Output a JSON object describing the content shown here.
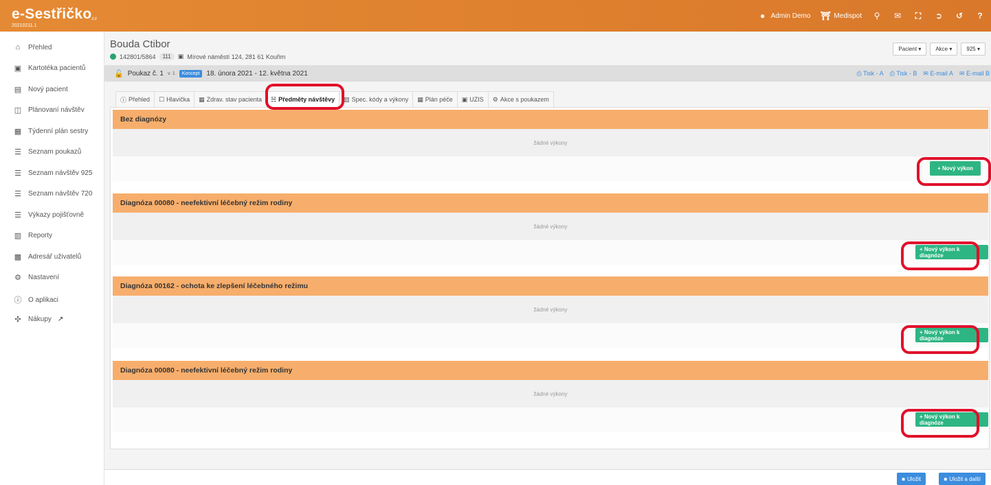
{
  "app": {
    "logo": "e-Sestřičko",
    "logo_tld": ".cz",
    "version": "20210211.1"
  },
  "topbar": {
    "user": "Admin Demo",
    "org": "Medispot"
  },
  "sidebar": {
    "items": [
      {
        "label": "Přehled",
        "icon": "home-icon"
      },
      {
        "label": "Kartotéka pacientů",
        "icon": "card-icon"
      },
      {
        "label": "Nový pacient",
        "icon": "id-icon"
      },
      {
        "label": "Plánovaní návštěv",
        "icon": "map-icon"
      },
      {
        "label": "Týdenní plán sestry",
        "icon": "calendar-icon"
      },
      {
        "label": "Seznam poukazů",
        "icon": "list-icon"
      },
      {
        "label": "Seznam návštěv 925",
        "icon": "list-icon"
      },
      {
        "label": "Seznam návštěv 720",
        "icon": "list-icon"
      },
      {
        "label": "Výkazy pojišťovně",
        "icon": "list-icon"
      },
      {
        "label": "Reporty",
        "icon": "chart-icon"
      },
      {
        "label": "Adresář uživatelů",
        "icon": "contact-icon"
      },
      {
        "label": "Nastavení",
        "icon": "gear-icon"
      },
      {
        "label": "O aplikaci",
        "icon": "info-icon"
      },
      {
        "label": "Nákupy",
        "icon": "cart-icon"
      }
    ]
  },
  "patient": {
    "name": "Bouda Ctibor",
    "id": "142801/5864",
    "insurance": "111",
    "address": "Mírové náměstí 124, 281 61 Kouřim"
  },
  "header_buttons": {
    "patient": "Pacient",
    "actions": "Akce",
    "code": "925"
  },
  "voucher": {
    "label": "Poukaz č. 1",
    "version": "v. 1",
    "status": "Koncept",
    "dates": "18. února 2021 - 12. května 2021",
    "links": [
      "Tisk - A",
      "Tisk - B",
      "E-mail A",
      "E-mail B"
    ]
  },
  "tabs": [
    {
      "label": "Přehled"
    },
    {
      "label": "Hlavička"
    },
    {
      "label": "Zdrav. stav pacienta"
    },
    {
      "label": "Předměty návštěvy",
      "active": true
    },
    {
      "label": "Spec. kódy a výkony"
    },
    {
      "label": "Plán péče"
    },
    {
      "label": "UZIS"
    },
    {
      "label": "Akce s poukazem"
    }
  ],
  "sections": [
    {
      "title": "Bez diagnózy",
      "empty": "žádné výkony",
      "button": "+ Nový výkon"
    },
    {
      "title": "Diagnóza 00080 - neefektivní léčebný režim rodiny",
      "empty": "žádné výkony",
      "button": "+ Nový výkon k diagnóze"
    },
    {
      "title": "Diagnóza 00162 - ochota ke zlepšení léčebného režimu",
      "empty": "žádné výkony",
      "button": "+ Nový výkon k diagnóze"
    },
    {
      "title": "Diagnóza 00080 - neefektivní léčebný režim rodiny",
      "empty": "žádné výkony",
      "button": "+ Nový výkon k diagnóze"
    }
  ],
  "footer": {
    "save": "Uložit",
    "save_next": "Uložit a další"
  },
  "colors": {
    "topbar": "#e58a34",
    "section_header": "#f7ae6c",
    "accent_green": "#2eb584",
    "accent_blue": "#3c8dde",
    "highlight": "#e0102b"
  }
}
